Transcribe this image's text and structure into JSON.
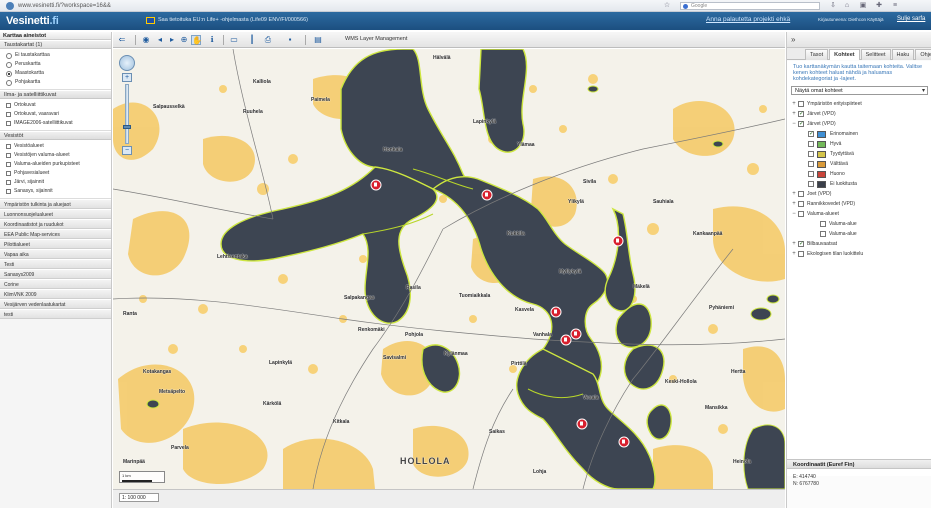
{
  "browser": {
    "url": "www.vesinetti.fi/?workspace=16&&",
    "search_placeholder": "Google"
  },
  "app": {
    "logo_main": "Vesinetti",
    "logo_tld": ".fi",
    "banner": "Saa tietoituka EU:n Life+ -ohjelmasta (Life09 ENV/FI/000566)",
    "feedback_link": "Anna palautetta projekti ehkä",
    "user_info": "Kirjautuneena: Diethcon Käyttäjä",
    "logout": "Sulje sarfa"
  },
  "left_panel": {
    "title": "Karttaa aineistot",
    "background_maps": {
      "header": "Taustakartat (1)",
      "items": [
        {
          "label": "Ei taustakarttaa",
          "selected": false
        },
        {
          "label": "Peruskartta",
          "selected": false
        },
        {
          "label": "Maastokartta",
          "selected": true
        },
        {
          "label": "Pohjakartta",
          "selected": false
        }
      ]
    },
    "orthophotos": {
      "header": "Ilma- ja satelliittikuvat",
      "items": [
        {
          "label": "Ortokuvat",
          "checked": false
        },
        {
          "label": "Ortokuvat, vaaravari",
          "checked": false
        },
        {
          "label": "IMAGE2006-satelliittikuvat",
          "checked": false
        }
      ]
    },
    "waters": {
      "header": "Vesistöt",
      "items": [
        {
          "label": "Vesistöalueet",
          "checked": false
        },
        {
          "label": "Vesistöjen valuma-alueet",
          "checked": false
        },
        {
          "label": "Valuma-alueiden purkupisteet",
          "checked": false
        },
        {
          "label": "Pohjavesialueet",
          "checked": false
        },
        {
          "label": "Järvi, sijainnit",
          "checked": false
        },
        {
          "label": "Sanasys, sijainnit",
          "checked": false
        }
      ]
    },
    "sections": [
      "Ympäristön tulkinta ja aluejaot",
      "Luonnonsuojelualueet",
      "Koordinaatistot ja ruudukot",
      "EEA Public Map-services",
      "Pilottialueet",
      "Vapaa aika",
      "Testi",
      "Sanasys2009",
      "Corine",
      "KlimVNK 2009",
      "Vesijärven vedenlaatukartat",
      "testi"
    ]
  },
  "toolbar": {
    "wms_label": "WMS Layer Management"
  },
  "map": {
    "places": [
      "Hälvälä",
      "Lehtisentaka",
      "Honkala",
      "Ruuhela",
      "Rasila",
      "Tuomiaikkala",
      "Salpakangas",
      "Kukkila",
      "Myllykylä",
      "Kasvela",
      "Vanhala",
      "Pohjola",
      "Savisalmi",
      "Kylänmaa",
      "Pirttilä",
      "Lapinkylä",
      "Renkomäki",
      "Vesala",
      "Kärkölä",
      "Kitkala",
      "Metsäpelto",
      "Parvela",
      "Ranta",
      "Kotakangas",
      "Sauhiala",
      "Mäkelä",
      "Kankaanpää",
      "Sivila",
      "Ylämaa",
      "Lapinkylä",
      "Paimela",
      "Kalliola",
      "Salpausselkä",
      "Pyhäniemi",
      "Keski-Hollola",
      "Ylikylä",
      "Saikas",
      "Mansikka",
      "Hertta",
      "Lohja",
      "Heinola",
      "Marinpää"
    ],
    "town_label": "HOLLOLA",
    "scale_caption": "1 km",
    "scale_select": "1: 100 000"
  },
  "right_panel": {
    "tabs": [
      "Tasot",
      "Kohteet",
      "Selitteet",
      "Haku",
      "Ohje"
    ],
    "active_tab": "Kohteet",
    "help_text": "Tuo karttanäkymän kautta taitemaan kohteita. Valitse kenen kohteet haluat nähdä ja haluamas kohdekategoriat ja -lajeet.",
    "select_value": "Näytä omat kohteet",
    "tree": [
      {
        "label": "Ympäristön erityispiirteet",
        "level": 0,
        "expander": "+",
        "checked": false
      },
      {
        "label": "Järvet (VPD)",
        "level": 0,
        "expander": "+",
        "checked": true
      },
      {
        "label": "Järvet (VPD)",
        "level": 0,
        "expander": "−",
        "checked": true
      },
      {
        "label": "Erinomainen",
        "level": 1,
        "expander": "",
        "checked": true,
        "swatch": "#3f8fd4"
      },
      {
        "label": "Hyvä",
        "level": 1,
        "expander": "",
        "checked": false,
        "swatch": "#73b95a"
      },
      {
        "label": "Tyydyttävä",
        "level": 1,
        "expander": "",
        "checked": false,
        "swatch": "#d4c44a"
      },
      {
        "label": "Välttävä",
        "level": 1,
        "expander": "",
        "checked": false,
        "swatch": "#d99a3a"
      },
      {
        "label": "Huono",
        "level": 1,
        "expander": "",
        "checked": false,
        "swatch": "#c9443a"
      },
      {
        "label": "Ei luokitusta",
        "level": 1,
        "expander": "",
        "checked": false,
        "swatch": "#3a3f4a"
      },
      {
        "label": "Joet (VPD)",
        "level": 0,
        "expander": "+",
        "checked": false
      },
      {
        "label": "Rannikkovedet (VPD)",
        "level": 0,
        "expander": "+",
        "checked": false
      },
      {
        "label": "Valuma-alueet",
        "level": 0,
        "expander": "−",
        "checked": false
      },
      {
        "label": "Valuma-alue",
        "level": 2,
        "expander": "",
        "checked": false
      },
      {
        "label": "Valuma-alue",
        "level": 2,
        "expander": "",
        "checked": false
      },
      {
        "label": "Bilbauvaatsat",
        "level": 0,
        "expander": "+",
        "checked": true
      },
      {
        "label": "Ekologisen tilan luokittelu",
        "level": 0,
        "expander": "+",
        "checked": false
      }
    ],
    "coords_header": "Koordinaatit (Euref Fin)",
    "coord_e": "E: 414740",
    "coord_n": "N: 6767780"
  },
  "colors": {
    "lake_fill": "#3d4552",
    "lake_outline": "#cde640",
    "sand_fill": "#f5cb6a",
    "marker": "#d8202e",
    "header_blue": "#2c6aa0"
  }
}
